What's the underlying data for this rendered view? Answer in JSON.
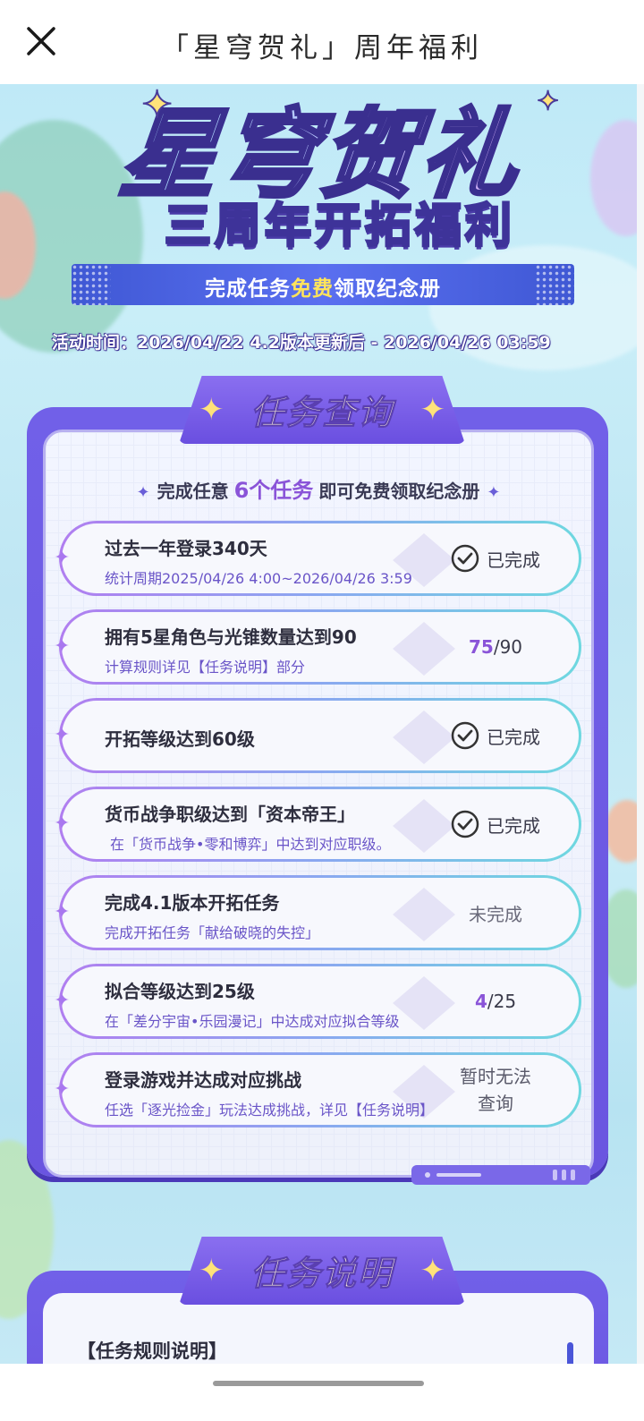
{
  "topbar": {
    "title": "「星穹贺礼」周年福利",
    "close_icon": "close-icon"
  },
  "hero": {
    "main_title": "星穹贺礼",
    "sub_title": "三周年开拓福利",
    "banner_prefix": "完成任务",
    "banner_highlight": "免费",
    "banner_suffix": "领取纪念册",
    "activity_time": "活动时间：2026/04/22 4.2版本更新后 - 2026/04/26 03:59"
  },
  "tasks_panel": {
    "header": "任务查询",
    "intro_prefix": "完成任意",
    "intro_count": "6个任务",
    "intro_suffix": "即可免费领取纪念册",
    "tasks": [
      {
        "title": "过去一年登录340天",
        "subtitle": "统计周期2025/04/26 4:00~2026/04/26 3:59",
        "status": "已完成",
        "status_type": "done"
      },
      {
        "title": "拥有5星角色与光锥数量达到90",
        "subtitle": "计算规则详见【任务说明】部分",
        "progress_current": "75",
        "progress_total": "/90",
        "status_type": "progress"
      },
      {
        "title": "开拓等级达到60级",
        "subtitle": "",
        "status": "已完成",
        "status_type": "done"
      },
      {
        "title": "货币战争职级达到「资本帝王」",
        "subtitle": "在「货币战争•零和博弈」中达到对应职级。",
        "status": "已完成",
        "status_type": "done"
      },
      {
        "title": "完成4.1版本开拓任务",
        "subtitle": "完成开拓任务「献给破晓的失控」",
        "status": "未完成",
        "status_type": "todo"
      },
      {
        "title": "拟合等级达到25级",
        "subtitle": "在「差分宇宙•乐园漫记」中达成对应拟合等级",
        "progress_current": "4",
        "progress_total": "/25",
        "status_type": "progress"
      },
      {
        "title": "登录游戏并达成对应挑战",
        "subtitle": "任选「逐光捡金」玩法达成挑战，详见【任务说明】",
        "status_line1": "暂时无法",
        "status_line2": "查询",
        "status_type": "unavailable"
      }
    ]
  },
  "rules_panel": {
    "header": "任务说明",
    "rules_title": "【任务规则说明】"
  },
  "colors": {
    "panel_purple": "#6a55e0",
    "accent_purple": "#8a54d8",
    "banner_blue": "#4a62e0",
    "highlight_yellow": "#ffe45a"
  }
}
